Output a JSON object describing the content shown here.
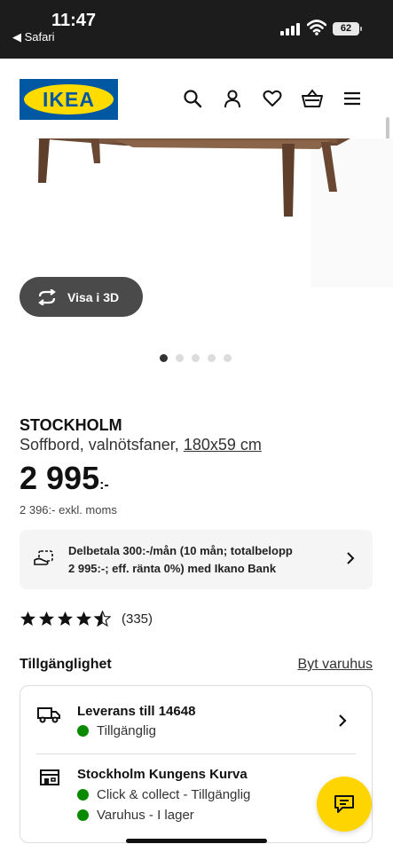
{
  "status_bar": {
    "time": "11:47",
    "back_app": "◀ Safari",
    "battery": "62"
  },
  "header": {
    "logo_text": "IKEA",
    "icons": [
      "search-icon",
      "user-icon",
      "heart-icon",
      "basket-icon",
      "menu-icon"
    ]
  },
  "gallery": {
    "view_3d_label": "Visa i 3D",
    "dot_count": 5,
    "active_dot": 0
  },
  "product": {
    "name": "STOCKHOLM",
    "description": "Soffbord, valnötsfaner,",
    "size": "180x59 cm",
    "price": "2 995",
    "price_suffix": ":-",
    "price_ex_vat": "2 396:- exkl. moms"
  },
  "installment": {
    "line1": "Delbetala 300:-/mån (10 mån; totalbelopp",
    "line2": "2 995:-; eff. ränta 0%) med Ikano Bank"
  },
  "rating": {
    "stars": 4.5,
    "count": "(335)"
  },
  "availability": {
    "title": "Tillgänglighet",
    "change_store": "Byt varuhus",
    "delivery": {
      "title": "Leverans till 14648",
      "status": "Tillgänglig"
    },
    "store": {
      "title": "Stockholm Kungens Kurva",
      "status_click_collect": "Click & collect - Tillgänglig",
      "status_store": "Varuhus - I lager"
    }
  },
  "colors": {
    "ikea_blue": "#0058a3",
    "ikea_yellow": "#ffdb00",
    "available_green": "#0a8a00",
    "chat_yellow": "#ffd500"
  }
}
